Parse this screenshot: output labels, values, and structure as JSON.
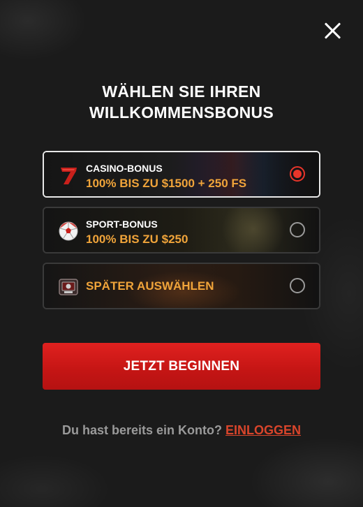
{
  "dialog": {
    "title_line1": "WÄHLEN SIE IHREN",
    "title_line2": "WILLKOMMENSBONUS"
  },
  "options": [
    {
      "icon": "red-seven-icon",
      "title": "CASINO-BONUS",
      "subtitle": "100% BIS ZU $1500 + 250 FS",
      "selected": true
    },
    {
      "icon": "soccer-ball-icon",
      "title": "SPORT-BONUS",
      "subtitle": "100% BIS ZU $250",
      "selected": false
    },
    {
      "icon": "bonus-box-icon",
      "title": "SPÄTER AUSWÄHLEN",
      "selected": false
    }
  ],
  "cta_label": "JETZT BEGINNEN",
  "login": {
    "prompt": "Du hast bereits ein Konto?",
    "link": "EINLOGGEN"
  },
  "colors": {
    "accent_red": "#d42019",
    "accent_orange": "#f0a43a",
    "background": "#1b1b1b"
  }
}
